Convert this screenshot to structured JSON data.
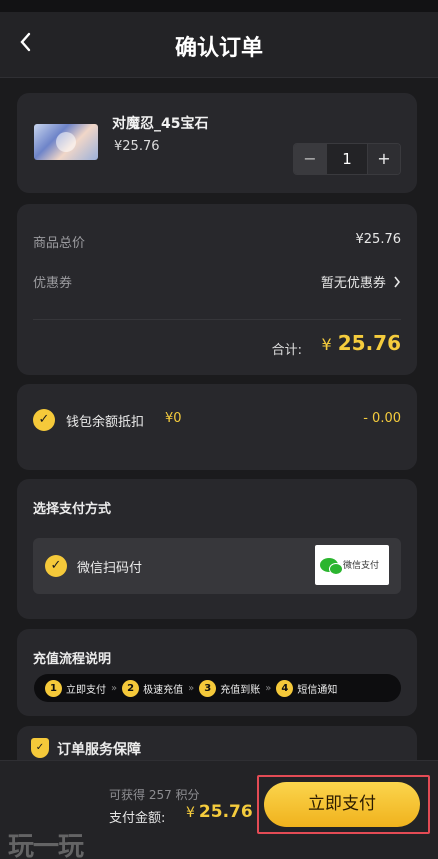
{
  "header": {
    "back_icon": "chevron-left-icon",
    "title": "确认订单"
  },
  "product": {
    "name": "对魔忍_45宝石",
    "price": "¥25.76",
    "quantity": "1",
    "minus": "−",
    "plus": "+"
  },
  "summary": {
    "total_label": "商品总价",
    "total_value": "¥25.76",
    "coupon_label": "优惠券",
    "coupon_value": "暂无优惠券",
    "grand_label": "合计:",
    "grand_currency": "¥",
    "grand_value": "25.76"
  },
  "wallet": {
    "label": "钱包余额抵扣",
    "amount": "¥0",
    "deduction": "- 0.00",
    "checked": true
  },
  "payment": {
    "section_title": "选择支付方式",
    "option_label": "微信扫码付",
    "logo_text": "微信支付",
    "checked": true
  },
  "flow": {
    "title": "充值流程说明",
    "steps": [
      {
        "num": "1",
        "label": "立即支付"
      },
      {
        "num": "2",
        "label": "极速充值"
      },
      {
        "num": "3",
        "label": "充值到账"
      },
      {
        "num": "4",
        "label": "短信通知"
      }
    ],
    "separator": "»"
  },
  "guarantee": {
    "title": "订单服务保障",
    "icon": "shield-check-icon"
  },
  "footer": {
    "points": "可获得 257 积分",
    "amount_label": "支付金额:",
    "amount_currency": "¥",
    "amount_value": "25.76",
    "pay_button": "立即支付"
  },
  "watermark": "玩一玩",
  "colors": {
    "accent": "#f5c93a",
    "background": "#1b1b1d",
    "card": "#28282c",
    "highlight_border": "#e34b55"
  }
}
